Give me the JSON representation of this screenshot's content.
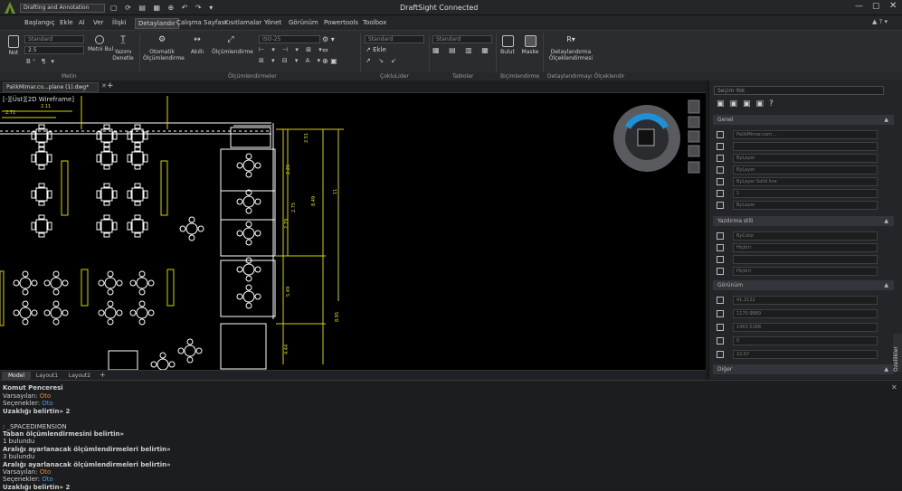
{
  "titlebar": {
    "workspace": "Drafting and Annotation",
    "app_title": "DraftSight Connected"
  },
  "menu": [
    "Başlangıç",
    "Ekle",
    "Al",
    "Ver",
    "İlişki",
    "Detaylandır",
    "Çalışma Sayfası",
    "Kısıtlamalar",
    "Yönet",
    "Görünüm",
    "Powertools",
    "Toolbox"
  ],
  "menu_active_index": 5,
  "ribbon": {
    "not_label": "Not",
    "metin_bul": "Metni Bul",
    "yazimi_denetle": [
      "Yazımı",
      "Denetle"
    ],
    "otomatik": [
      "Otomatik",
      "Ölçümlendirme"
    ],
    "akilli": "Akıllı",
    "olcumlendirme": "Ölçümlendirme",
    "ekle": "Ekle",
    "bulut": "Bulut",
    "maske": "Maske",
    "detay_olc": [
      "Detaylandırma",
      "Ölçeklendirmesi"
    ],
    "text_style": "Standard",
    "text_height": "2.5",
    "dim_style": "ISO-25",
    "leader_style": "Standard",
    "table_style": "Standard",
    "group_labels": [
      "Metin",
      "Ölçümlendirmeler",
      "ÇokluLider",
      "Tablolar",
      "Biçimlendirme",
      "Detaylandırmayı Ölçeklendir"
    ]
  },
  "doc_tab": "PalikMimar.co...plane (1).dwg*",
  "view_label": "[-][Üst][2D Wireframe]",
  "layout_tabs": [
    "Model",
    "Layout1",
    "Layout2"
  ],
  "props": {
    "filter": "Seçim Yok",
    "sections": [
      "Genel",
      "Yazdırma stili",
      "Görünüm",
      "Diğer"
    ],
    "genel_rows": [
      "PalikMimar.com...",
      "",
      "ByLayer",
      "ByLayer",
      "ByLayer    Solid line",
      "1",
      "ByLayer"
    ],
    "yazdirma_rows": [
      "ByColor",
      "Hiçbiri",
      "",
      "Hiçbiri"
    ],
    "gorunum_rows": [
      "41.2122",
      "1170.9889",
      "1463.5168",
      "0",
      "22.67"
    ],
    "side_tab": "Özellikler"
  },
  "command": {
    "title": "Komut Penceresi",
    "lines": [
      {
        "t": "Varsayılan: ",
        "v": "Oto",
        "c": "orange",
        "b": false
      },
      {
        "t": "Seçenekler: ",
        "v": "Oto",
        "c": "blue",
        "b": false
      },
      {
        "t": "Uzaklığı belirtin» 2",
        "v": "",
        "c": "",
        "b": true
      },
      {
        "t": "",
        "v": "",
        "c": "",
        "b": false
      },
      {
        "t": ": _SPACEDIMENSION",
        "v": "",
        "c": "",
        "b": false
      },
      {
        "t": "Taban ölçümlendirmesini belirtin»",
        "v": "",
        "c": "",
        "b": true
      },
      {
        "t": "1 bulundu",
        "v": "",
        "c": "",
        "b": false
      },
      {
        "t": "Aralığı ayarlanacak ölçümlendirmeleri belirtin»",
        "v": "",
        "c": "",
        "b": true
      },
      {
        "t": "3 bulundu",
        "v": "",
        "c": "",
        "b": false
      },
      {
        "t": "Aralığı ayarlanacak ölçümlendirmeleri belirtin»",
        "v": "",
        "c": "",
        "b": true
      },
      {
        "t": "Varsayılan: ",
        "v": "Oto",
        "c": "orange",
        "b": false
      },
      {
        "t": "Seçenekler: ",
        "v": "Oto",
        "c": "blue",
        "b": false
      },
      {
        "t": "Uzaklığı belirtin» 2",
        "v": "",
        "c": "",
        "b": true
      }
    ]
  },
  "dims": [
    "2.71",
    "2.11",
    "2.51",
    "2.26",
    "2.79",
    "2.75",
    "8.49",
    "11",
    "5.49",
    "8.95",
    "4.44"
  ]
}
